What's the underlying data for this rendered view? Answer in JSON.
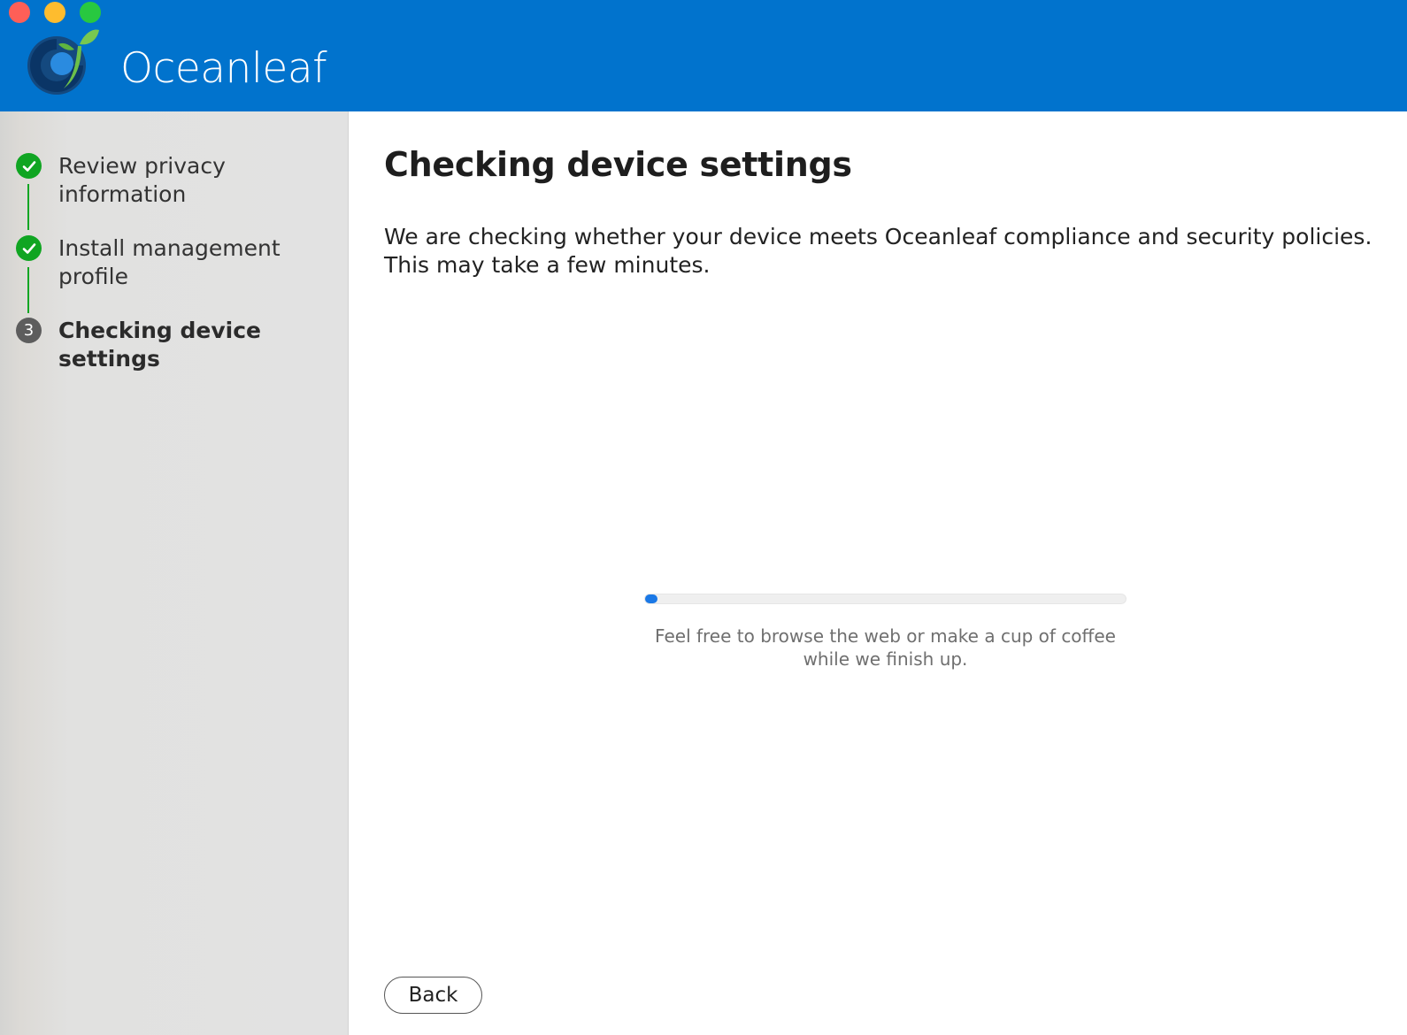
{
  "window": {
    "controls": [
      "close",
      "minimize",
      "maximize"
    ],
    "colors": {
      "close": "#fe5f57",
      "minimize": "#febc2e",
      "maximize": "#28c840"
    }
  },
  "header": {
    "app_name": "Oceanleaf",
    "background_color": "#0173cd",
    "logo_icon": "oceanleaf-logo"
  },
  "sidebar": {
    "steps": [
      {
        "label": "Review privacy information",
        "status": "complete",
        "icon": "checkmark-icon"
      },
      {
        "label": "Install management profile",
        "status": "complete",
        "icon": "checkmark-icon"
      },
      {
        "label": "Checking device settings",
        "status": "current",
        "number": "3"
      }
    ],
    "complete_color": "#10a522"
  },
  "main": {
    "title": "Checking device settings",
    "description": "We are checking whether your device meets Oceanleaf compliance and security policies. This may take a few minutes.",
    "progress": {
      "value_percent": 2,
      "note": "Feel free to browse the web or make a cup of coffee while we finish up.",
      "bar_color": "#1a78e6"
    },
    "back_label": "Back"
  }
}
